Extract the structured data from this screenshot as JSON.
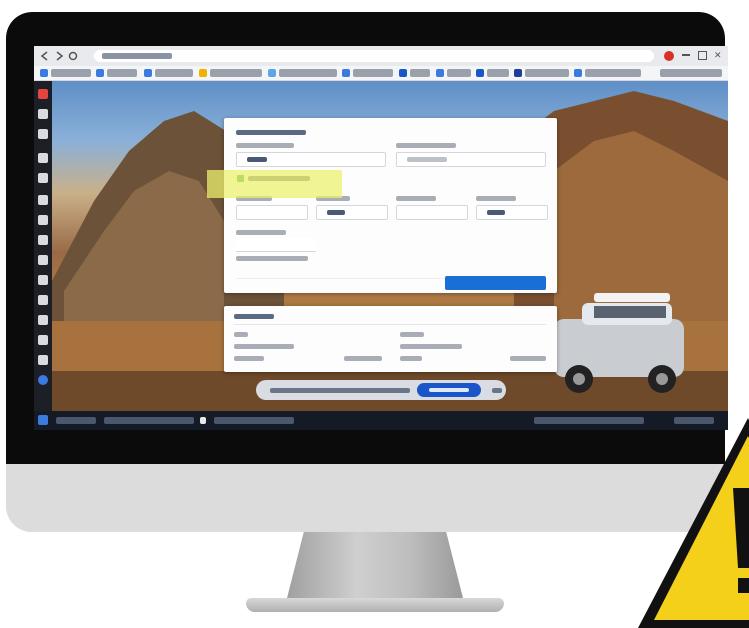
{
  "browser": {
    "window_controls": [
      "minimize",
      "maximize",
      "close"
    ],
    "bookmark_count": 12
  },
  "form": {
    "highlight_color": "#ecf06e",
    "accent": "#1a6fd6"
  },
  "cookie_banner": {
    "button_color": "#1a56c8"
  },
  "colors": {
    "bezel": "#0b0b0b",
    "chin": "#dcdcdc",
    "warning_yellow": "#f5d01a",
    "warning_border": "#111111"
  },
  "icons": [
    "back-icon",
    "forward-icon",
    "reload-icon",
    "home-icon",
    "warning-icon"
  ]
}
